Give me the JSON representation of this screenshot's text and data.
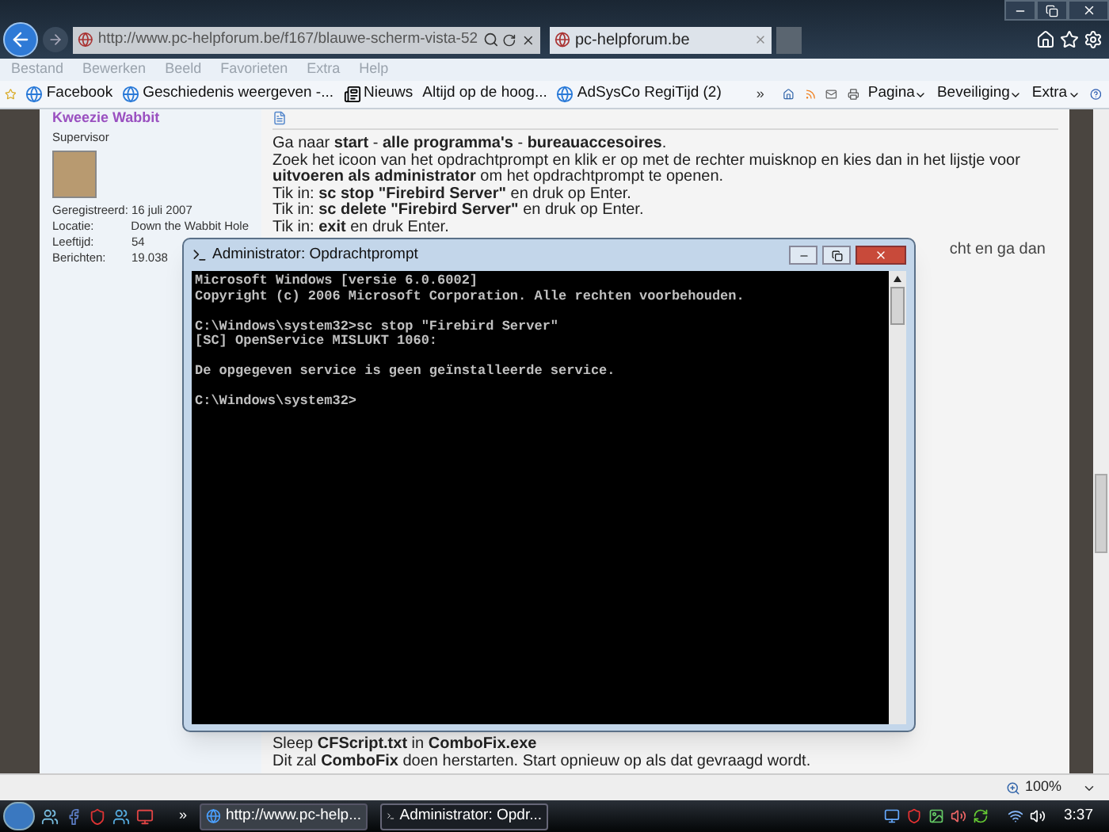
{
  "browser": {
    "address": "http://www.pc-helpforum.be/f167/blauwe-scherm-vista-52",
    "tab": {
      "title": "pc-helpforum.be"
    },
    "menu": [
      "Bestand",
      "Bewerken",
      "Beeld",
      "Favorieten",
      "Extra",
      "Help"
    ],
    "favorites": [
      {
        "kind": "ie",
        "label": "Facebook"
      },
      {
        "kind": "ie",
        "label": "Geschiedenis weergeven -..."
      },
      {
        "kind": "news",
        "label": "Nieuws"
      },
      {
        "kind": "plain",
        "label": "Altijd op de hoog..."
      },
      {
        "kind": "ie",
        "label": "AdSysCo RegiTijd (2)"
      }
    ],
    "overflow": "»",
    "command_bar": [
      "Pagina",
      "Beveiliging",
      "Extra"
    ],
    "zoom": "100%"
  },
  "profile": {
    "name": "Kweezie Wabbit",
    "title": "Supervisor",
    "fields": [
      {
        "label": "Geregistreerd:",
        "value": "16 juli 2007"
      },
      {
        "label": "Locatie:",
        "value": "Down the Wabbit Hole"
      },
      {
        "label": "Leeftijd:",
        "value": "54"
      },
      {
        "label": "Berichten:",
        "value": "19.038"
      }
    ]
  },
  "post": {
    "lines": [
      "Ga naar **start** - **alle programma's** - **bureauaccesoires**.",
      "Zoek het icoon van het opdrachtprompt en klik er op met de rechter muisknop en kies dan in het lijstje voor **uitvoeren als administrator** om het opdrachtprompt te openen.",
      "Tik in: **sc stop \"Firebird Server\"** en druk op Enter.",
      "Tik in: **sc delete \"Firebird Server\"** en druk op Enter.",
      "Tik in: **exit** en druk Enter."
    ],
    "covered_fragment": "cht en ga dan",
    "bottom_lines": [
      "Sleep **CFScript.txt** in **ComboFix.exe**",
      "Dit zal **ComboFix** doen herstarten. Start opnieuw op als dat gevraagd wordt."
    ]
  },
  "console": {
    "title": "Administrator: Opdrachtprompt",
    "blocks": [
      [
        "Microsoft Windows [versie 6.0.6002]",
        "Copyright (c) 2006 Microsoft Corporation. Alle rechten voorbehouden."
      ],
      [
        "C:\\Windows\\system32>sc stop \"Firebird Server\"",
        "[SC] OpenService MISLUKT 1060:"
      ],
      [
        "De opgegeven service is geen geïnstalleerde service."
      ],
      [
        "C:\\Windows\\system32>"
      ]
    ]
  },
  "taskbar": {
    "overflow": "»",
    "tasks": [
      {
        "kind": "browser",
        "label": "http://www.pc-help...",
        "selected": false
      },
      {
        "kind": "console",
        "label": "Administrator: Opdr...",
        "selected": true
      }
    ],
    "clock": "3:37"
  }
}
